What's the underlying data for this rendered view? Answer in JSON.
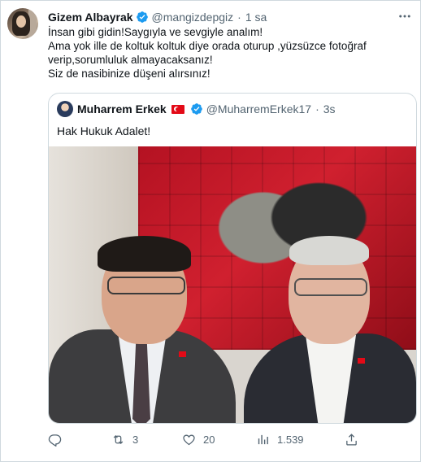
{
  "tweet": {
    "author_name": "Gizem Albayrak",
    "handle": "@mangizdepgiz",
    "separator": "·",
    "time": "1 sa",
    "lines": [
      "İnsan gibi gidin!Saygıyla ve sevgiyle analım!",
      "Ama yok ille de koltuk koltuk diye orada oturup ,yüzsüzce fotoğraf",
      "verip,sorumluluk almayacaksanız!",
      "Siz de nasibinize düşeni alırsınız!"
    ]
  },
  "quoted": {
    "author_name": "Muharrem Erkek",
    "handle": "@MuharremErkek17",
    "separator": "·",
    "time": "3s",
    "text": "Hak Hukuk Adalet!"
  },
  "actions": {
    "reply_count": "",
    "retweet_count": "3",
    "like_count": "20",
    "view_count": "1.539"
  },
  "icons": [
    "verified-badge-icon",
    "more-icon",
    "turkish-flag-icon",
    "reply-icon",
    "retweet-icon",
    "like-icon",
    "views-icon",
    "share-icon"
  ],
  "colors": {
    "verified": "#1d9bf0",
    "muted": "#536471",
    "border": "#cfd9de",
    "flag": "#e30a17"
  }
}
